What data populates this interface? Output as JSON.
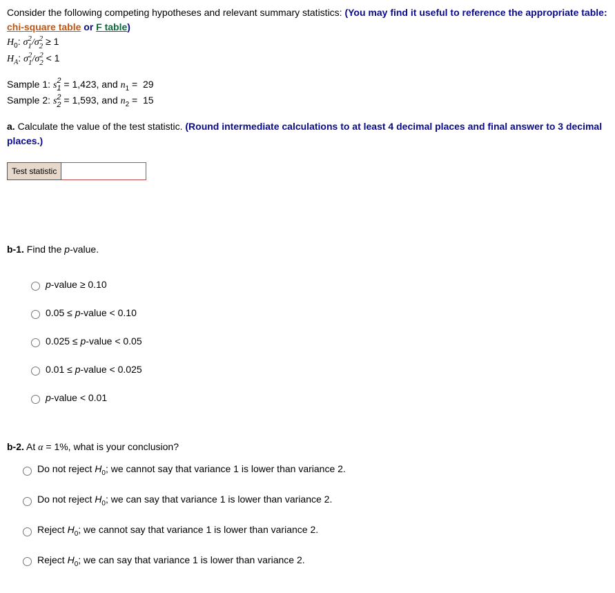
{
  "intro": {
    "lead": "Consider the following competing hypotheses and relevant summary statistics: ",
    "note_prefix": "(You may find it useful to reference the appropriate table: ",
    "chi_link": "chi-square table",
    "or": " or ",
    "f_link": "F table",
    "note_suffix": ")"
  },
  "hypotheses": {
    "h0_label": "H",
    "h0_sub": "0",
    "ha_label": "H",
    "ha_sub": "A",
    "colon": ": ",
    "ratio_sym_sigma": "σ",
    "ratio_sup": "2",
    "ratio_sub1": "1",
    "ratio_slash": "/",
    "ratio_sub2": "2",
    "ge": " ≥ 1",
    "lt": " < 1"
  },
  "samples": {
    "s1_prefix": "Sample 1:  ",
    "s_sym": "s",
    "sup2": "2",
    "sub1": "1",
    "sub2": "2",
    "eq": " = ",
    "s1_val": "1,423",
    "and": ", and ",
    "n_sym": "n",
    "n1_val": "29",
    "s2_prefix": "Sample 2:  ",
    "s2_val": "1,593",
    "n2_val": "15"
  },
  "part_a": {
    "label": "a.",
    "text": " Calculate the value of the test statistic. ",
    "hint": "(Round intermediate calculations to at least 4 decimal places and final answer to 3 decimal places.)",
    "row_label": "Test statistic"
  },
  "part_b1": {
    "label": "b-1.",
    "text": " Find the ",
    "p": "p",
    "text2": "-value.",
    "options": [
      "-value ≥ 0.10",
      "0.05 ≤ p-value < 0.10",
      "0.025 ≤ p-value < 0.05",
      "0.01 ≤ p-value < 0.025",
      "-value < 0.01"
    ]
  },
  "part_b2": {
    "label": "b-2.",
    "text_pre": " At ",
    "alpha": "α",
    "text_mid": " = 1%, what is your conclusion?",
    "options": [
      "Do not reject H0; we cannot say that variance 1 is lower than variance 2.",
      "Do not reject H0; we can say that variance 1 is lower than variance 2.",
      "Reject H0; we cannot say that variance 1 is lower than variance 2.",
      "Reject H0; we can say that variance 1 is lower than variance 2."
    ]
  }
}
